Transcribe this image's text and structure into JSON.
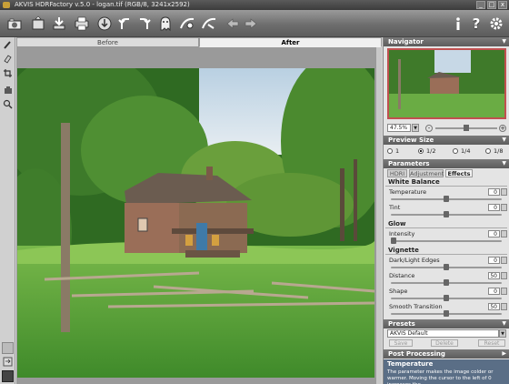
{
  "window": {
    "title": "AKVIS HDRFactory v.5.0 - logan.tif (RGB/8, 3241x2592)",
    "buttons": [
      "_",
      "□",
      "x"
    ]
  },
  "toolbar": {
    "icons": [
      "open-icon",
      "save-icon",
      "print-icon",
      "export-icon",
      "undo-icon",
      "redo-icon",
      "ghost-icon",
      "hdr-icon",
      "process-icon",
      "back-icon",
      "forward-icon",
      "info-icon",
      "help-icon",
      "settings-icon"
    ]
  },
  "view_tabs": {
    "before": "Before",
    "after": "After"
  },
  "navigator": {
    "title": "Navigator",
    "zoom": "47.5%",
    "zoom_level": 0.5
  },
  "preview_size": {
    "title": "Preview Size",
    "options": [
      "1",
      "1/2",
      "1/4",
      "1/8"
    ],
    "selected": "1/2"
  },
  "parameters": {
    "title": "Parameters",
    "tabs": [
      "HDRI",
      "Adjustment",
      "Effects"
    ],
    "active_tab": "Effects",
    "groups": [
      {
        "title": "White Balance",
        "items": [
          {
            "label": "Temperature",
            "value": "0",
            "level": 0.5
          },
          {
            "label": "Tint",
            "value": "0",
            "level": 0.5
          }
        ]
      },
      {
        "title": "Glow",
        "items": [
          {
            "label": "Intensity",
            "value": "0",
            "level": 0.0
          }
        ]
      },
      {
        "title": "Vignette",
        "items": [
          {
            "label": "Dark/Light Edges",
            "value": "0",
            "level": 0.5
          },
          {
            "label": "Distance",
            "value": "50",
            "level": 0.5
          },
          {
            "label": "Shape",
            "value": "0",
            "level": 0.5
          },
          {
            "label": "Smooth Transition",
            "value": "50",
            "level": 0.5
          }
        ]
      }
    ]
  },
  "presets": {
    "title": "Presets",
    "selected": "AKVIS Default",
    "save_label": "Save",
    "delete_label": "Delete",
    "reset_label": "Reset"
  },
  "post_processing": {
    "title": "Post Processing"
  },
  "hint": {
    "title": "Temperature",
    "text": "The parameter makes the image colder or warmer. Moving the cursor to the left of 0 increases the"
  },
  "colors": {
    "toolbar_top": "#9a9a9a",
    "header_bar": "#6a6a6a",
    "hint_bg": "#5a6e86"
  }
}
